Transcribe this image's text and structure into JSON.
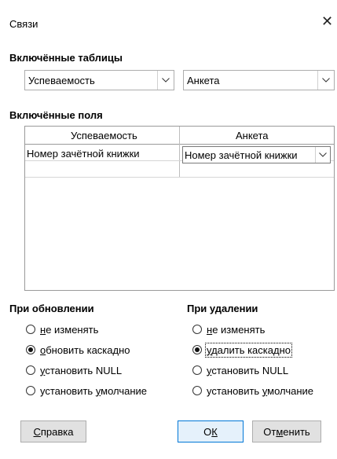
{
  "window": {
    "title": "Связи"
  },
  "tables": {
    "label": "Включённые таблицы",
    "left": "Успеваемость",
    "right": "Анкета"
  },
  "fields": {
    "label": "Включённые поля",
    "columns": [
      "Успеваемость",
      "Анкета"
    ],
    "rows": [
      {
        "left": "Номер зачётной книжки",
        "right": "Номер зачётной книжки"
      }
    ]
  },
  "on_update": {
    "label": "При обновлении",
    "options": [
      {
        "pre": "",
        "u": "н",
        "post": "е изменять",
        "selected": false
      },
      {
        "pre": "",
        "u": "о",
        "post": "бновить каскадно",
        "selected": true
      },
      {
        "pre": "",
        "u": "у",
        "post": "становить NULL",
        "selected": false
      },
      {
        "pre": "установить ",
        "u": "у",
        "post": "молчание",
        "selected": false
      }
    ]
  },
  "on_delete": {
    "label": "При удалении",
    "options": [
      {
        "pre": "",
        "u": "н",
        "post": "е изменять",
        "selected": false
      },
      {
        "pre": "",
        "u": "у",
        "post": "далить каскадно",
        "selected": true
      },
      {
        "pre": "",
        "u": "у",
        "post": "становить NULL",
        "selected": false
      },
      {
        "pre": "установить ",
        "u": "у",
        "post": "молчание",
        "selected": false
      }
    ]
  },
  "buttons": {
    "help": {
      "pre": "",
      "u": "С",
      "post": "правка"
    },
    "ok": {
      "pre": "О",
      "u": "К",
      "post": ""
    },
    "cancel": {
      "pre": "От",
      "u": "м",
      "post": "енить"
    }
  }
}
